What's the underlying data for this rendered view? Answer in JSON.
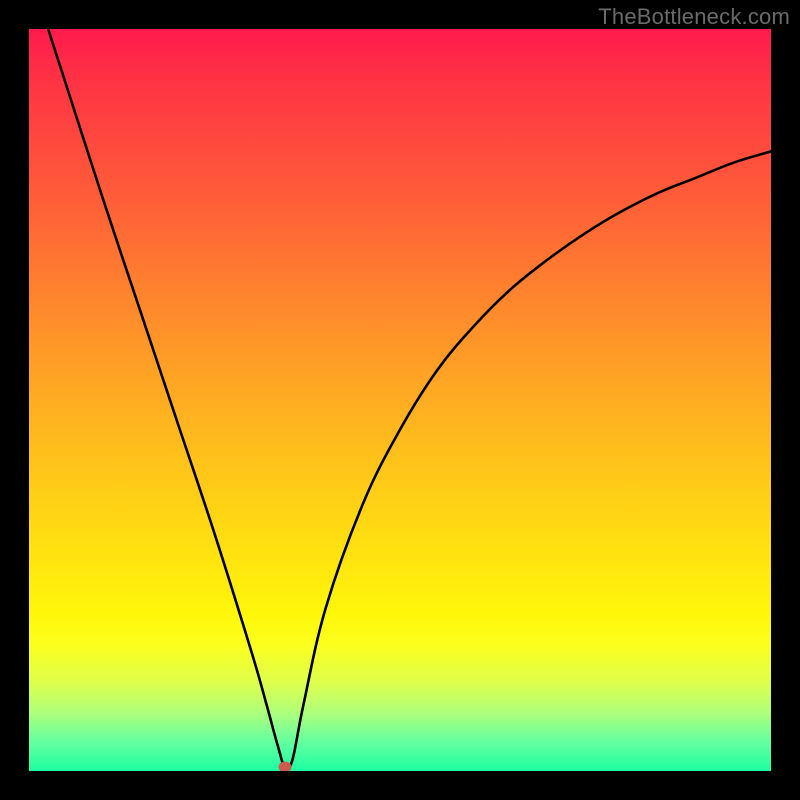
{
  "watermark": "TheBottleneck.com",
  "chart_data": {
    "type": "line",
    "title": "",
    "xlabel": "",
    "ylabel": "",
    "xlim": [
      0,
      100
    ],
    "ylim": [
      0,
      100
    ],
    "minimum_marker": {
      "x": 34.5,
      "y": 0.5
    },
    "series": [
      {
        "name": "curve",
        "x": [
          0,
          5,
          10,
          15,
          20,
          25,
          30,
          32,
          33.5,
          34.5,
          35.5,
          37,
          40,
          45,
          50,
          55,
          60,
          65,
          70,
          75,
          80,
          85,
          90,
          95,
          100
        ],
        "values": [
          108,
          92.5,
          77,
          62,
          47,
          32,
          16,
          9,
          3.5,
          0.5,
          1.5,
          9,
          22,
          36,
          46,
          54,
          60,
          65,
          69,
          72.5,
          75.5,
          78,
          80,
          82,
          83.5
        ]
      }
    ],
    "colors": {
      "curve_stroke": "#000000",
      "marker_fill": "#cf594a"
    }
  }
}
